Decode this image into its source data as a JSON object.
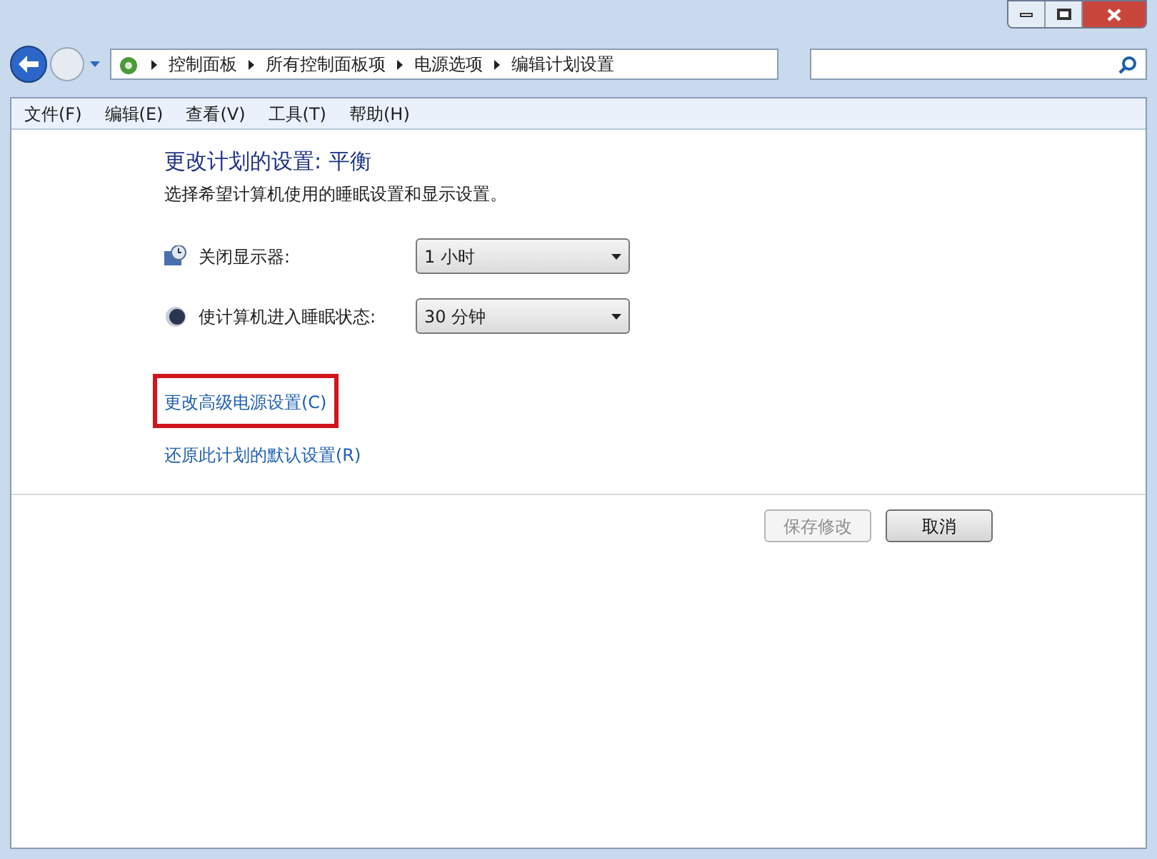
{
  "breadcrumb": [
    "控制面板",
    "所有控制面板项",
    "电源选项",
    "编辑计划设置"
  ],
  "menu": [
    "文件(F)",
    "编辑(E)",
    "查看(V)",
    "工具(T)",
    "帮助(H)"
  ],
  "heading": "更改计划的设置: 平衡",
  "description": "选择希望计算机使用的睡眠设置和显示设置。",
  "settings": [
    {
      "kind": "display",
      "label": "关闭显示器:",
      "value": "1 小时"
    },
    {
      "kind": "sleep",
      "label": "使计算机进入睡眠状态:",
      "value": "30 分钟"
    }
  ],
  "links": [
    {
      "label": "更改高级电源设置(C)",
      "highlighted": true
    },
    {
      "label": "还原此计划的默认设置(R)",
      "highlighted": false
    }
  ],
  "buttons": [
    {
      "label": "保存修改",
      "disabled": true
    },
    {
      "label": "取消",
      "disabled": false
    }
  ]
}
